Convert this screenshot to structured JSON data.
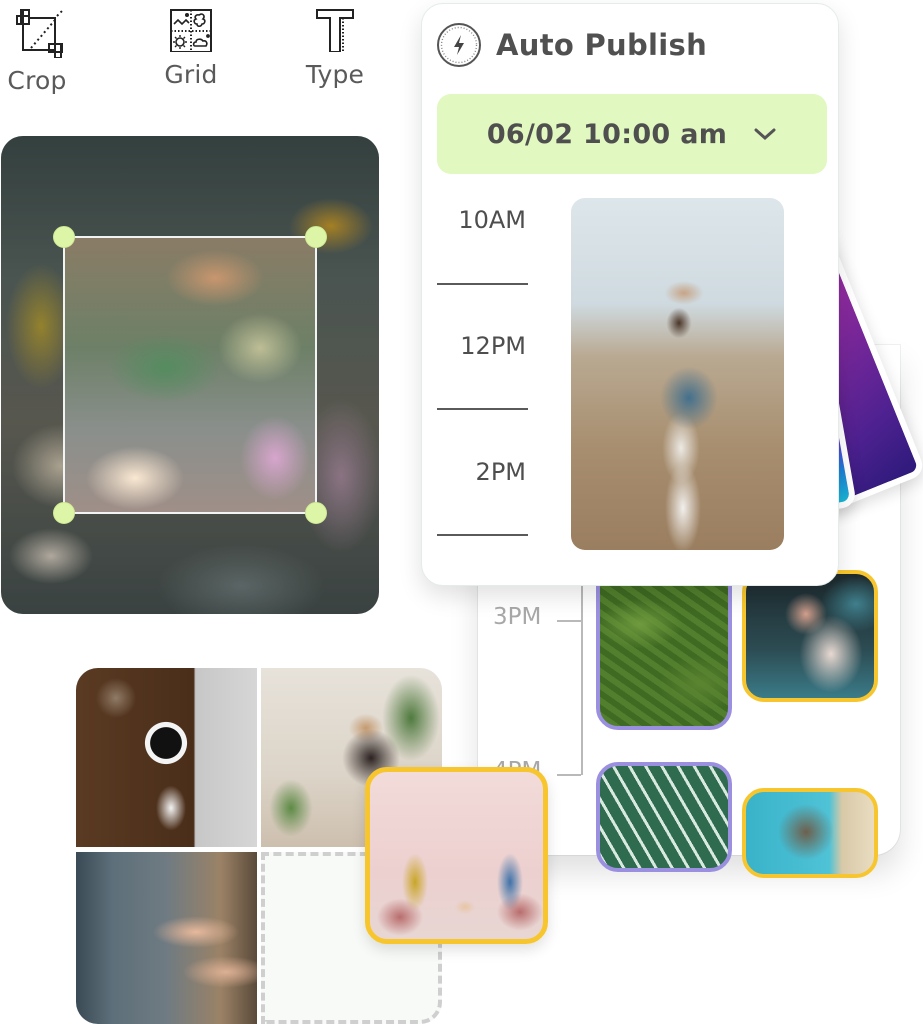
{
  "toolbar": {
    "tools": [
      {
        "label": "Crop",
        "icon": "crop-icon"
      },
      {
        "label": "Grid",
        "icon": "grid-icon"
      },
      {
        "label": "Type",
        "icon": "type-icon"
      }
    ]
  },
  "crop_editor": {
    "image": "flower-market-photo",
    "handle_color": "#ddf5a7"
  },
  "auto_publish": {
    "title": "Auto Publish",
    "icon": "lightning-bolt-icon",
    "date_select": {
      "value": "06/02 10:00 am",
      "icon": "chevron-down-icon",
      "background": "#e1f8c0"
    },
    "time_slots": [
      "10AM",
      "12PM",
      "2PM"
    ],
    "feature_image": "woman-in-hat-field-photo",
    "stacked_cards": [
      "purple-gradient-card",
      "violet-gradient-card"
    ]
  },
  "schedule_panel": {
    "time_slots": [
      "3PM",
      "4PM"
    ],
    "thumbnails": [
      {
        "image": "green-leaves-dew-photo",
        "border": "#9b8fe0"
      },
      {
        "image": "cat-with-butterfly-photo",
        "border": "#f7c62f"
      },
      {
        "image": "striped-leaves-photo",
        "border": "#9b8fe0"
      },
      {
        "image": "cat-peeking-photo",
        "border": "#f7c62f"
      }
    ]
  },
  "grid_collage": {
    "cells": [
      {
        "image": "desk-coffee-laptop-photo"
      },
      {
        "image": "woman-writing-plants-photo"
      },
      {
        "image": "hands-pointing-laptop-photo"
      },
      {
        "image": "empty-drop-slot"
      }
    ],
    "dragged_image": {
      "image": "two-women-chatting-photo",
      "border": "#f7c62f"
    }
  }
}
